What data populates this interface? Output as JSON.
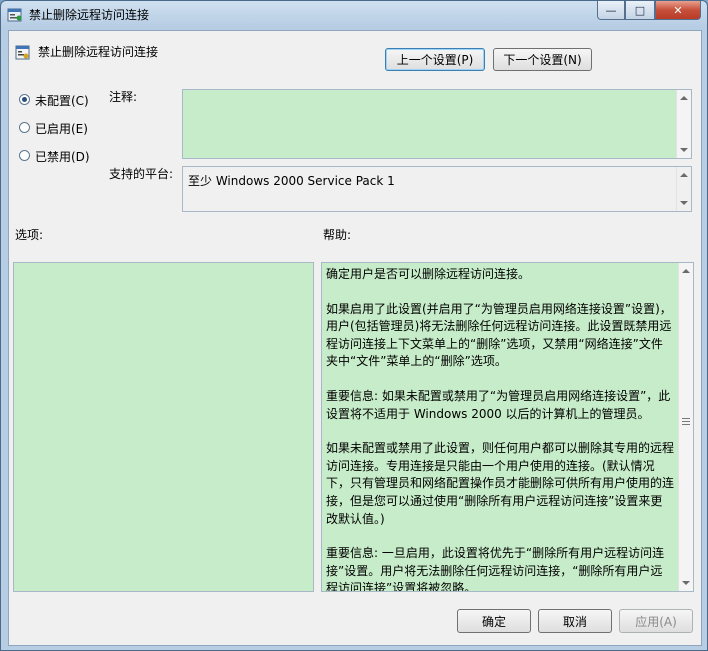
{
  "window": {
    "title": "禁止删除远程访问连接",
    "minimize_glyph": "—",
    "maximize_glyph": "□",
    "close_glyph": "✕"
  },
  "header": {
    "setting_name": "禁止删除远程访问连接",
    "prev_button": "上一个设置(P)",
    "next_button": "下一个设置(N)"
  },
  "state": {
    "options": [
      {
        "label": "未配置(C)",
        "selected": true
      },
      {
        "label": "已启用(E)",
        "selected": false
      },
      {
        "label": "已禁用(D)",
        "selected": false
      }
    ]
  },
  "comment": {
    "label": "注释:",
    "value": ""
  },
  "platform": {
    "label": "支持的平台:",
    "value": "至少 Windows 2000 Service Pack 1"
  },
  "options_panel": {
    "label": "选项:"
  },
  "help_panel": {
    "label": "帮助:",
    "paragraphs": [
      "确定用户是否可以删除远程访问连接。",
      "如果启用了此设置(并启用了“为管理员启用网络连接设置”设置)，用户(包括管理员)将无法删除任何远程访问连接。此设置既禁用远程访问连接上下文菜单上的“删除”选项，又禁用“网络连接”文件夹中“文件”菜单上的“删除”选项。",
      "重要信息: 如果未配置或禁用了“为管理员启用网络连接设置”，此设置将不适用于 Windows 2000 以后的计算机上的管理员。",
      "如果未配置或禁用了此设置，则任何用户都可以删除其专用的远程访问连接。专用连接是只能由一个用户使用的连接。(默认情况下，只有管理员和网络配置操作员才能删除可供所有用户使用的连接，但是您可以通过使用“删除所有用户远程访问连接”设置来更改默认值。)",
      "重要信息: 一旦启用，此设置将优先于“删除所有用户远程访问连接”设置。用户将无法删除任何远程访问连接，“删除所有用户远程访问连接”设置将被忽略。"
    ]
  },
  "footer": {
    "ok_button": "确定",
    "cancel_button": "取消",
    "apply_button": "应用(A)"
  },
  "colors": {
    "panel_fill": "#c7ecc9",
    "dialog_bg": "#f0f0f0"
  }
}
